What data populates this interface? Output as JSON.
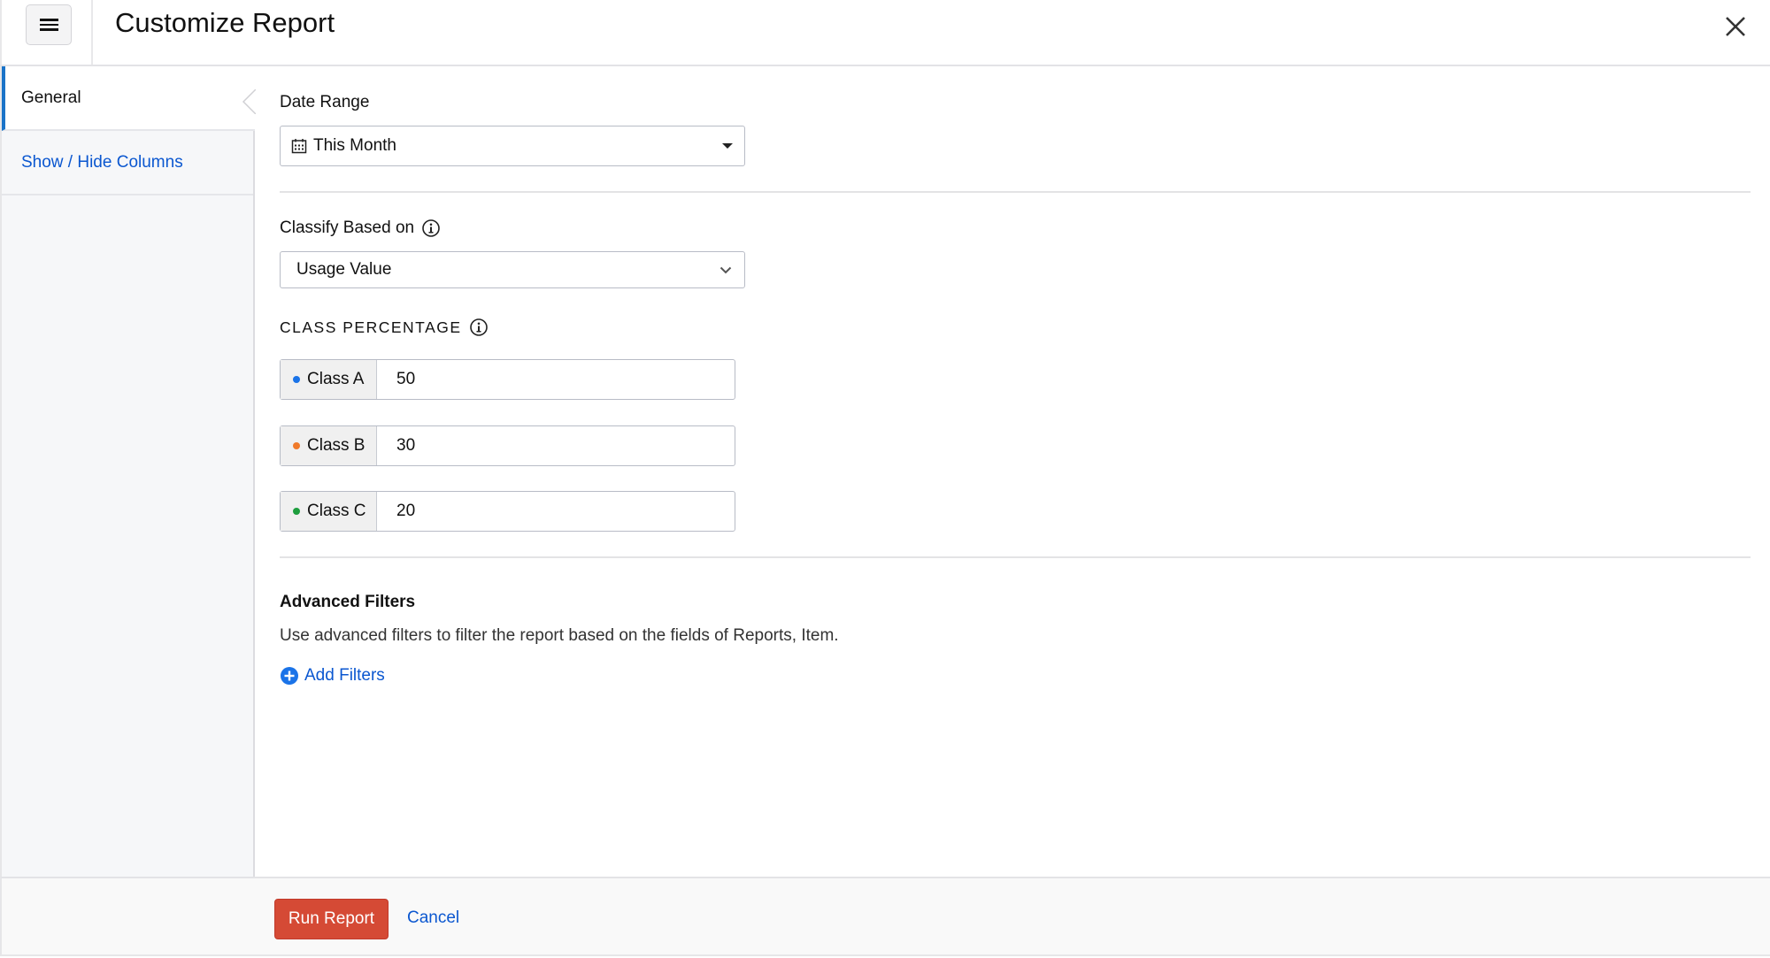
{
  "header": {
    "title": "Customize Report",
    "menu_icon": "hamburger-icon",
    "close_icon": "close-icon"
  },
  "sidebar": {
    "items": [
      {
        "label": "General",
        "active": true
      },
      {
        "label": "Show / Hide Columns",
        "active": false
      }
    ]
  },
  "date_range": {
    "label": "Date Range",
    "value": "This Month",
    "icon": "calendar-icon"
  },
  "classify": {
    "label": "Classify Based on",
    "value": "Usage Value"
  },
  "class_percentage": {
    "label": "CLASS PERCENTAGE",
    "classes": [
      {
        "label": "Class A",
        "value": "50",
        "color": "#1a73e8"
      },
      {
        "label": "Class B",
        "value": "30",
        "color": "#f07a2a"
      },
      {
        "label": "Class C",
        "value": "20",
        "color": "#1e9e3e"
      }
    ]
  },
  "advanced_filters": {
    "title": "Advanced Filters",
    "description": "Use advanced filters to filter the report based on the fields of Reports, Item.",
    "add_label": "Add Filters"
  },
  "footer": {
    "run_label": "Run Report",
    "cancel_label": "Cancel"
  },
  "colors": {
    "accent": "#0b57d0",
    "primary_button": "#d54a35",
    "active_indicator": "#1a73c8"
  }
}
